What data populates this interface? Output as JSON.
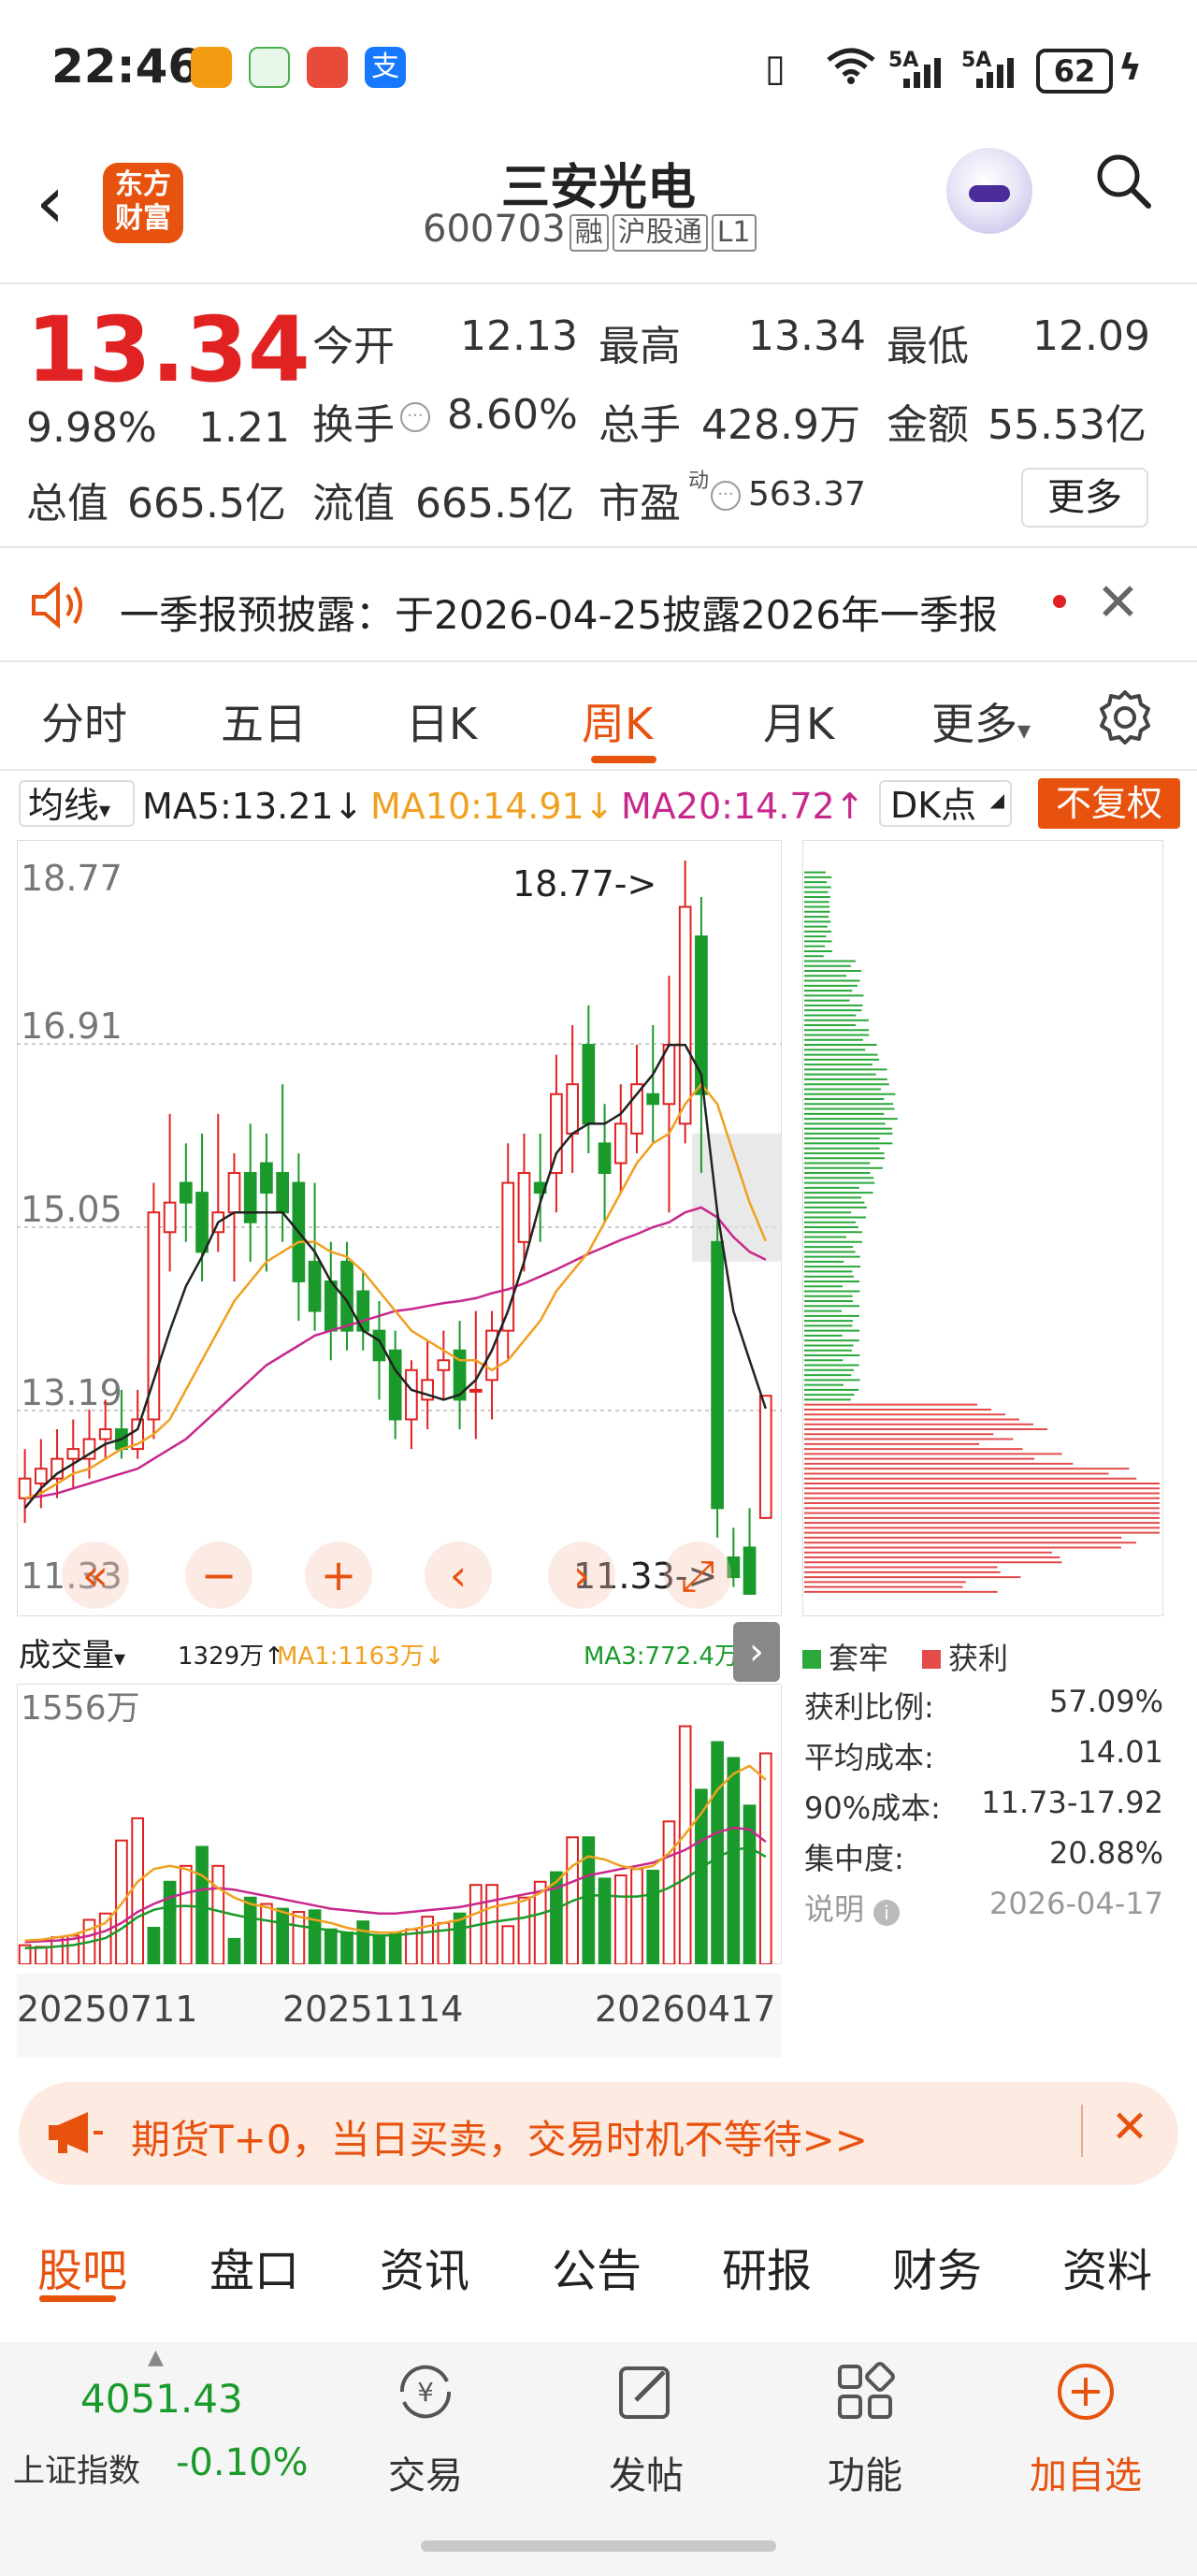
{
  "status_bar": {
    "time": "22:46",
    "network1": "5A",
    "network2": "5A",
    "battery": "62"
  },
  "header": {
    "back_symbol": "‹",
    "logo_line1": "东方",
    "logo_line2": "财富",
    "stock_name": "三安光电",
    "stock_code": "600703",
    "tags": [
      "融",
      "沪股通",
      "L1"
    ]
  },
  "quote": {
    "price": "13.34",
    "change_pct": "9.98%",
    "change": "1.21",
    "open_label": "今开",
    "open": "12.13",
    "high_label": "最高",
    "high": "13.34",
    "low_label": "最低",
    "low": "12.09",
    "turnover_label": "换手",
    "turnover": "8.60%",
    "volume_label": "总手",
    "volume": "428.9万",
    "amount_label": "金额",
    "amount": "55.53亿",
    "mktcap_label": "总值",
    "mktcap": "665.5亿",
    "float_label": "流值",
    "float_cap": "665.5亿",
    "pe_label": "市盈",
    "pe_sup": "动",
    "pe": "563.37",
    "more": "更多"
  },
  "notice": {
    "text": "一季报预披露：于2026-04-25披露2026年一季报"
  },
  "kline_tabs": [
    "分时",
    "五日",
    "日K",
    "周K",
    "月K",
    "更多"
  ],
  "active_tab": "周K",
  "ma_bar": {
    "selector": "均线",
    "ma5": "MA5:13.21↓",
    "ma10": "MA10:14.91↓",
    "ma20": "MA20:14.72↑",
    "dk": "DK点",
    "fq": "不复权"
  },
  "colors": {
    "up": "#e02222",
    "down": "#1a9a2a",
    "accent": "#e8520f",
    "ma5": "#222222",
    "ma10": "#f0a020",
    "ma20": "#c8288c"
  },
  "chart_data": [
    {
      "type": "candlestick",
      "title": "",
      "y_ticks": [
        "18.77",
        "16.91",
        "15.05",
        "13.19",
        "11.33"
      ],
      "ylim": [
        11.33,
        18.77
      ],
      "max_annotation": "18.77->",
      "min_annotation": "11.33->",
      "candles": [
        [
          12.3,
          12.5,
          12.8,
          12.05
        ],
        [
          12.45,
          12.6,
          12.9,
          12.2
        ],
        [
          12.5,
          12.7,
          13.0,
          12.3
        ],
        [
          12.7,
          12.8,
          13.1,
          12.4
        ],
        [
          12.7,
          12.9,
          13.2,
          12.5
        ],
        [
          12.9,
          13.0,
          13.3,
          12.7
        ],
        [
          13.0,
          12.8,
          13.4,
          12.7
        ],
        [
          12.8,
          13.1,
          13.4,
          12.7
        ],
        [
          13.1,
          15.2,
          15.5,
          12.9
        ],
        [
          15.0,
          15.3,
          16.2,
          14.6
        ],
        [
          15.5,
          15.3,
          15.9,
          14.9
        ],
        [
          15.4,
          14.8,
          16.0,
          14.5
        ],
        [
          15.0,
          15.2,
          16.2,
          14.8
        ],
        [
          15.2,
          15.6,
          15.8,
          14.5
        ],
        [
          15.6,
          15.1,
          16.1,
          14.7
        ],
        [
          15.7,
          15.4,
          16.0,
          14.6
        ],
        [
          15.6,
          15.2,
          16.5,
          14.9
        ],
        [
          15.5,
          14.5,
          15.8,
          14.1
        ],
        [
          14.7,
          14.2,
          15.5,
          14.0
        ],
        [
          14.5,
          14.0,
          14.9,
          13.7
        ],
        [
          14.7,
          14.0,
          14.9,
          13.8
        ],
        [
          14.4,
          14.0,
          14.6,
          13.8
        ],
        [
          14.0,
          13.7,
          14.3,
          13.3
        ],
        [
          13.8,
          13.1,
          14.0,
          12.9
        ],
        [
          13.1,
          13.6,
          13.7,
          12.8
        ],
        [
          13.3,
          13.5,
          13.9,
          13.0
        ],
        [
          13.6,
          13.7,
          14.0,
          13.3
        ],
        [
          13.8,
          13.3,
          14.1,
          13.0
        ],
        [
          13.4,
          13.4,
          14.2,
          12.9
        ],
        [
          13.5,
          14.0,
          14.2,
          13.1
        ],
        [
          14.0,
          15.5,
          15.9,
          13.7
        ],
        [
          14.9,
          15.6,
          16.0,
          14.6
        ],
        [
          15.5,
          15.4,
          16.0,
          14.9
        ],
        [
          15.6,
          16.4,
          16.8,
          15.2
        ],
        [
          16.0,
          16.5,
          17.1,
          15.6
        ],
        [
          16.9,
          16.1,
          17.3,
          15.8
        ],
        [
          15.9,
          15.6,
          16.3,
          15.1
        ],
        [
          15.7,
          16.1,
          16.5,
          15.4
        ],
        [
          16.0,
          16.5,
          16.9,
          15.8
        ],
        [
          16.4,
          16.3,
          17.1,
          15.9
        ],
        [
          16.3,
          16.9,
          17.6,
          15.2
        ],
        [
          16.1,
          18.3,
          18.77,
          15.9
        ],
        [
          18.0,
          16.4,
          18.4,
          15.6
        ],
        [
          14.9,
          12.2,
          15.2,
          11.9
        ],
        [
          11.7,
          11.5,
          12.0,
          11.4
        ],
        [
          11.8,
          11.33,
          12.2,
          11.33
        ],
        [
          12.1,
          13.34,
          13.34,
          12.09
        ]
      ],
      "ma5": [
        12.2,
        12.4,
        12.55,
        12.65,
        12.75,
        12.85,
        12.9,
        13.0,
        13.5,
        14.0,
        14.45,
        14.75,
        15.1,
        15.2,
        15.2,
        15.2,
        15.2,
        15.0,
        14.8,
        14.5,
        14.3,
        14.0,
        13.9,
        13.6,
        13.4,
        13.35,
        13.3,
        13.35,
        13.5,
        13.8,
        14.2,
        14.7,
        15.3,
        15.8,
        16.0,
        16.1,
        16.1,
        16.2,
        16.4,
        16.6,
        16.9,
        16.9,
        16.6,
        15.2,
        14.2,
        13.7,
        13.21
      ],
      "ma10": [
        12.3,
        12.35,
        12.45,
        12.55,
        12.6,
        12.7,
        12.8,
        12.85,
        12.95,
        13.1,
        13.4,
        13.7,
        14.0,
        14.3,
        14.5,
        14.7,
        14.8,
        14.9,
        14.9,
        14.8,
        14.75,
        14.6,
        14.4,
        14.2,
        14.0,
        13.9,
        13.8,
        13.7,
        13.7,
        13.6,
        13.7,
        13.9,
        14.1,
        14.4,
        14.6,
        14.8,
        15.1,
        15.4,
        15.7,
        15.9,
        16.0,
        16.3,
        16.5,
        16.3,
        15.8,
        15.3,
        14.91
      ],
      "ma20": [
        12.3,
        12.32,
        12.35,
        12.4,
        12.45,
        12.5,
        12.55,
        12.6,
        12.7,
        12.8,
        12.9,
        13.05,
        13.2,
        13.35,
        13.5,
        13.65,
        13.75,
        13.85,
        13.95,
        14.0,
        14.05,
        14.1,
        14.15,
        14.2,
        14.22,
        14.25,
        14.28,
        14.3,
        14.33,
        14.38,
        14.42,
        14.48,
        14.55,
        14.62,
        14.7,
        14.78,
        14.85,
        14.92,
        14.98,
        15.05,
        15.1,
        15.2,
        15.25,
        15.15,
        14.95,
        14.8,
        14.72
      ]
    },
    {
      "type": "bar",
      "title": "",
      "y_tick": "1556万",
      "ylim": [
        0,
        1556
      ],
      "legend": [
        "1329万↑",
        "MA1:1163万↓",
        "MA3:772.4万↑"
      ],
      "x_labels": [
        "20250711",
        "20251114",
        "20260417"
      ],
      "values": [
        120,
        110,
        170,
        180,
        280,
        320,
        780,
        920,
        230,
        520,
        620,
        740,
        620,
        160,
        420,
        380,
        350,
        330,
        340,
        220,
        200,
        270,
        180,
        200,
        220,
        300,
        260,
        320,
        500,
        500,
        240,
        420,
        520,
        580,
        800,
        800,
        540,
        560,
        600,
        590,
        900,
        1500,
        1100,
        1400,
        1300,
        1000,
        1329
      ],
      "up": [
        true,
        true,
        true,
        true,
        true,
        true,
        true,
        true,
        false,
        false,
        true,
        false,
        true,
        false,
        false,
        true,
        false,
        true,
        false,
        false,
        false,
        false,
        false,
        false,
        true,
        true,
        true,
        false,
        true,
        true,
        true,
        true,
        true,
        false,
        true,
        false,
        false,
        true,
        true,
        false,
        true,
        true,
        false,
        false,
        false,
        false,
        true
      ],
      "ma_a": [
        150,
        155,
        170,
        185,
        220,
        260,
        380,
        520,
        600,
        620,
        600,
        560,
        480,
        420,
        380,
        360,
        330,
        300,
        280,
        260,
        230,
        210,
        200,
        200,
        220,
        240,
        260,
        280,
        320,
        360,
        380,
        400,
        450,
        520,
        620,
        680,
        660,
        620,
        600,
        620,
        700,
        820,
        950,
        1100,
        1200,
        1250,
        1163
      ],
      "ma_b": [
        140,
        145,
        150,
        160,
        180,
        210,
        260,
        330,
        380,
        420,
        450,
        470,
        480,
        470,
        450,
        430,
        410,
        390,
        370,
        350,
        340,
        330,
        320,
        320,
        330,
        340,
        350,
        360,
        380,
        400,
        420,
        440,
        460,
        480,
        520,
        560,
        580,
        600,
        620,
        640,
        680,
        720,
        780,
        830,
        860,
        850,
        772.4
      ]
    }
  ],
  "chip_data": {
    "legend_trapped": "套牢",
    "legend_profit": "获利",
    "rows": [
      {
        "label": "获利比例:",
        "value": "57.09%"
      },
      {
        "label": "平均成本:",
        "value": "14.01"
      },
      {
        "label": "90%成本:",
        "value": "11.73-17.92"
      },
      {
        "label": "集中度:",
        "value": "20.88%"
      },
      {
        "label": "说明",
        "value": "2026-04-17"
      }
    ]
  },
  "vol_selector": "成交量",
  "banner": {
    "text": "期货T+0，当日买卖，交易时机不等待>>"
  },
  "bottom_tabs": [
    "股吧",
    "盘口",
    "资讯",
    "公告",
    "研报",
    "财务",
    "资料"
  ],
  "nav": {
    "index_value": "4051.43",
    "index_name": "上证指数",
    "index_change": "-0.10%",
    "items": [
      "交易",
      "发帖",
      "功能",
      "加自选"
    ]
  }
}
